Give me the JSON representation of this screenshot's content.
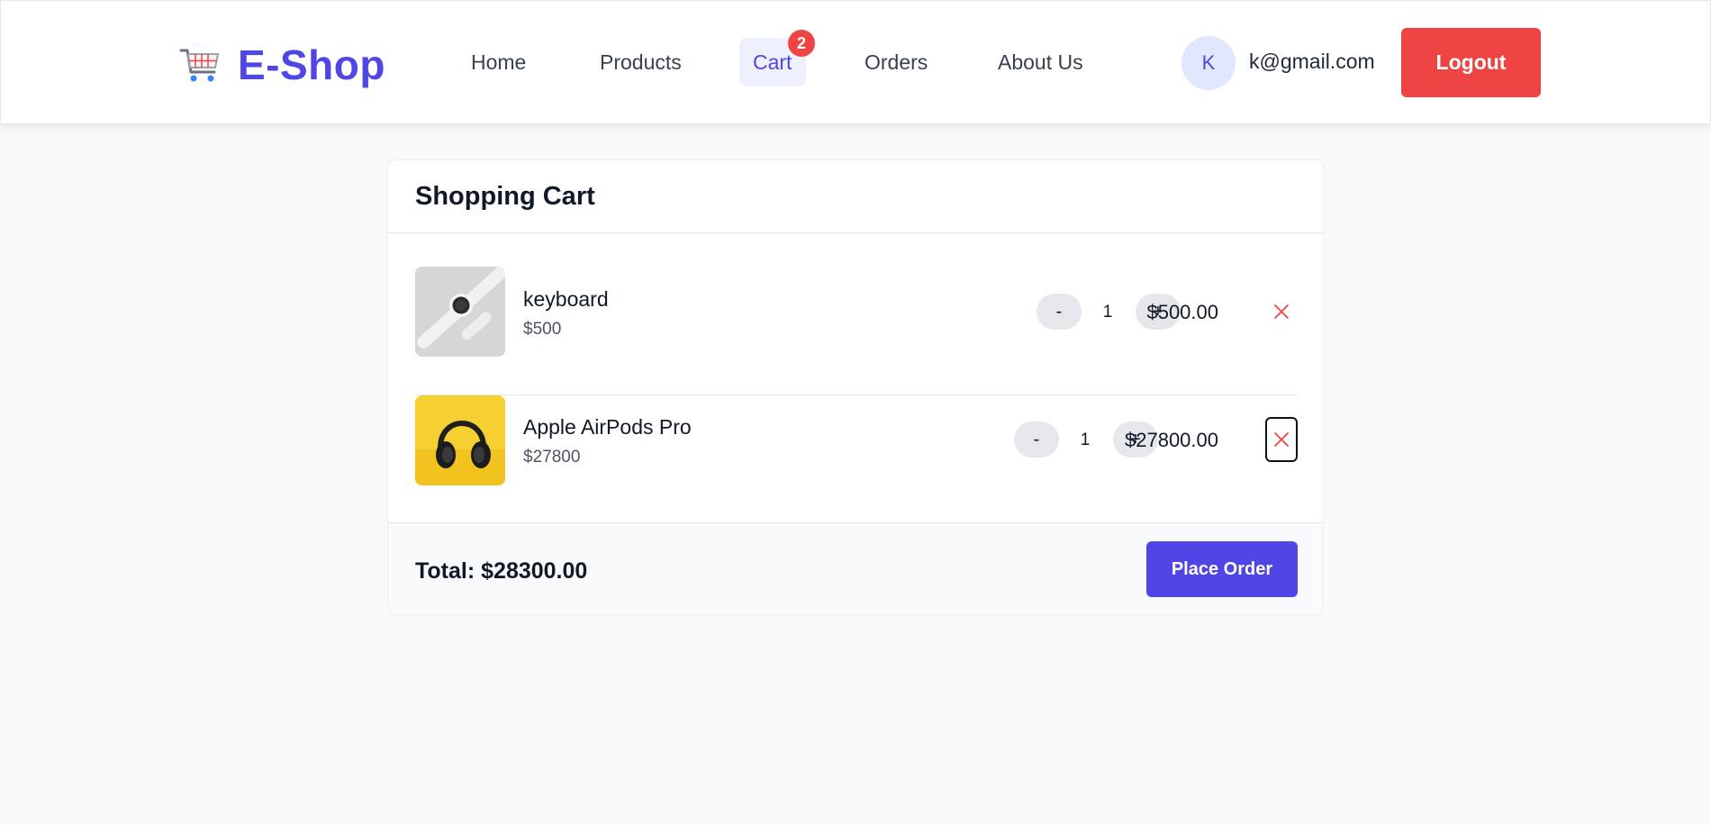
{
  "brand": {
    "name": "E-Shop",
    "icon": "shopping-cart-icon",
    "color": "#4f46e5"
  },
  "nav": {
    "home": "Home",
    "products": "Products",
    "cart": "Cart",
    "cart_count": "2",
    "orders": "Orders",
    "about": "About Us"
  },
  "user": {
    "initial": "K",
    "email": "k@gmail.com",
    "logout_label": "Logout"
  },
  "cart": {
    "title": "Shopping Cart",
    "items": [
      {
        "name": "keyboard",
        "unit_price": "$500",
        "quantity": "1",
        "line_total": "$500.00",
        "decrement": "-",
        "increment": "+",
        "image": "smartwatch-image"
      },
      {
        "name": "Apple AirPods Pro",
        "unit_price": "$27800",
        "quantity": "1",
        "line_total": "$27800.00",
        "decrement": "-",
        "increment": "+",
        "image": "headphones-image"
      }
    ],
    "total_label": "Total: $28300.00",
    "place_order_label": "Place Order"
  },
  "colors": {
    "accent": "#4f46e5",
    "danger": "#ef4444",
    "badge": "#ef4444",
    "page_bg": "#f8f9fb"
  }
}
